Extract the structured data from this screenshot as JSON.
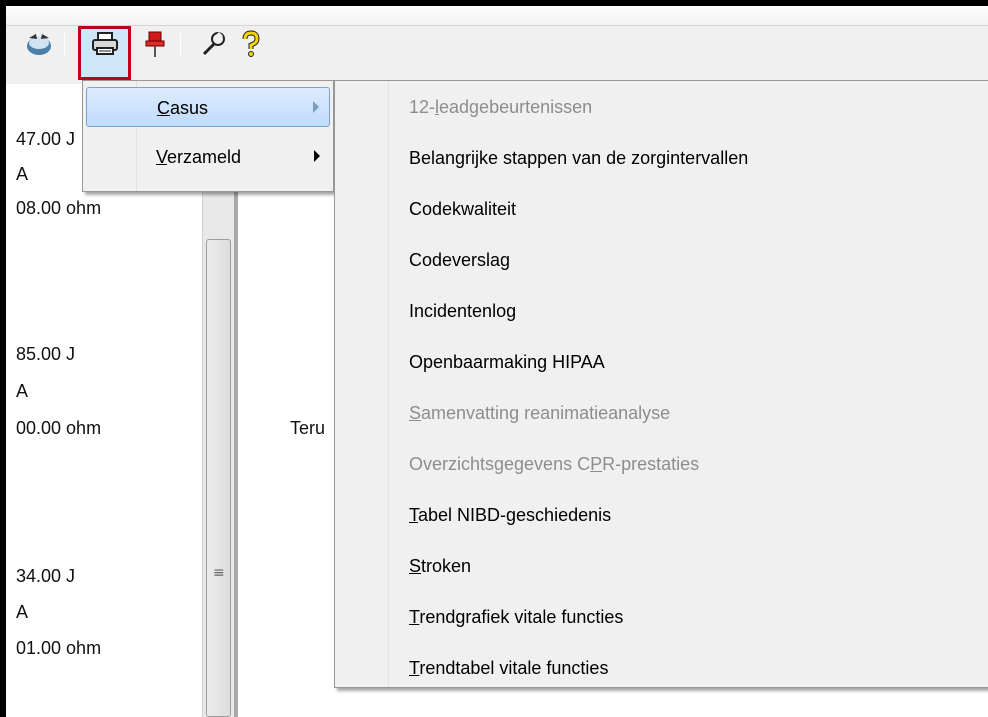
{
  "toolbar": {
    "icons": [
      "cloud-transfer-icon",
      "printer-icon",
      "pushpin-icon",
      "wrench-icon",
      "help-icon"
    ]
  },
  "readings": [
    "47.00 J",
    "A",
    "08.00 ohm",
    "85.00 J",
    "A",
    "00.00 ohm",
    "34.00 J",
    "A",
    "01.00 ohm"
  ],
  "main": {
    "partial_text": "Teru"
  },
  "print_menu": {
    "items": [
      {
        "pre": "",
        "u": "C",
        "post": "asus",
        "selected": true
      },
      {
        "pre": "",
        "u": "V",
        "post": "erzameld",
        "selected": false
      }
    ]
  },
  "casus_submenu": {
    "items": [
      {
        "pre": "12-",
        "u": "l",
        "post": "eadgebeurtenissen",
        "enabled": false
      },
      {
        "pre": "Belangrijke stappen van de zorgintervallen",
        "u": "",
        "post": "",
        "enabled": true
      },
      {
        "pre": "Codekwaliteit",
        "u": "",
        "post": "",
        "enabled": true
      },
      {
        "pre": "Codeverslag",
        "u": "",
        "post": "",
        "enabled": true
      },
      {
        "pre": "Incidentenlog",
        "u": "",
        "post": "",
        "enabled": true
      },
      {
        "pre": "Openbaarmaking HIPAA",
        "u": "",
        "post": "",
        "enabled": true
      },
      {
        "pre": "",
        "u": "S",
        "post": "amenvatting reanimatieanalyse",
        "enabled": false
      },
      {
        "pre": "Overzichtsgegevens C",
        "u": "P",
        "post": "R-prestaties",
        "enabled": false
      },
      {
        "pre": "",
        "u": "T",
        "post": "abel NIBD-geschiedenis",
        "enabled": true
      },
      {
        "pre": "",
        "u": "S",
        "post": "troken",
        "enabled": true
      },
      {
        "pre": "",
        "u": "T",
        "post": "rendgrafiek vitale functies",
        "enabled": true
      },
      {
        "pre": "",
        "u": "T",
        "post": "rendtabel vitale functies",
        "enabled": true
      }
    ]
  },
  "colors": {
    "highlight_border": "#c0001a",
    "disabled_text": "#8d8d8d",
    "menu_background": "#f0f0f0",
    "selection_border": "#7da2ce"
  }
}
